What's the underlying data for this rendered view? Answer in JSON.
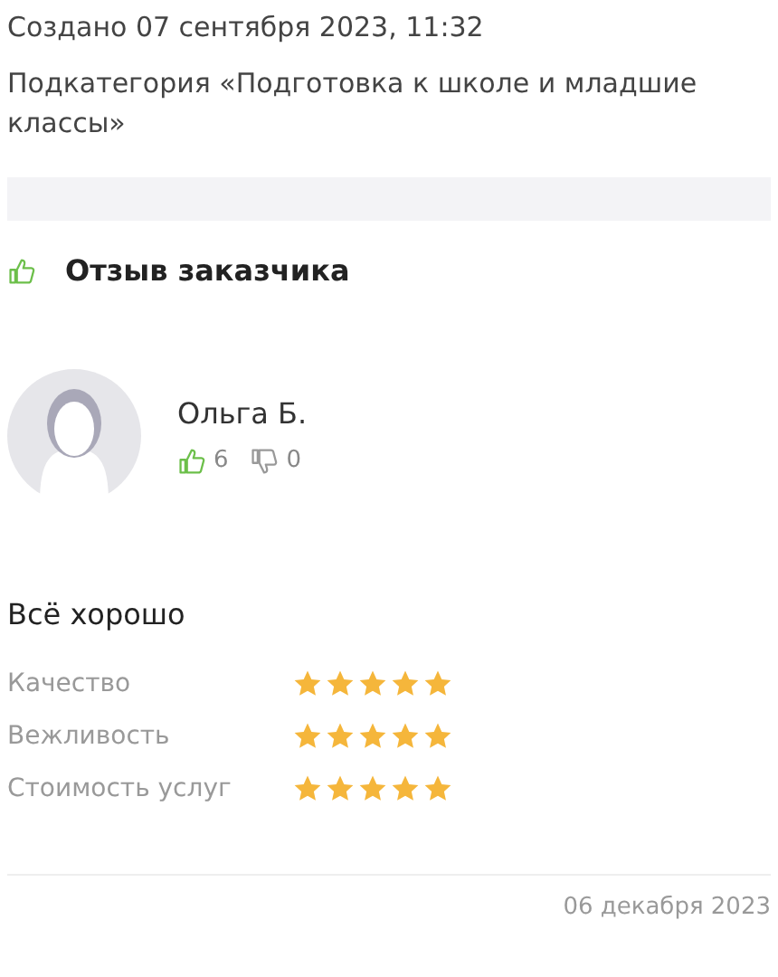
{
  "created": "Создано 07 сентября 2023, 11:32",
  "subcategory": "Подкатегория «Подготовка к школе и младшие классы»",
  "review": {
    "title": "Отзыв заказчика",
    "author": "Ольга Б.",
    "likes": "6",
    "dislikes": "0",
    "summary": "Всё хорошо",
    "ratings": [
      {
        "label": "Качество",
        "stars": 5
      },
      {
        "label": "Вежливость",
        "stars": 5
      },
      {
        "label": "Стоимость услуг",
        "stars": 5
      }
    ],
    "date": "06 декабря 2023"
  }
}
